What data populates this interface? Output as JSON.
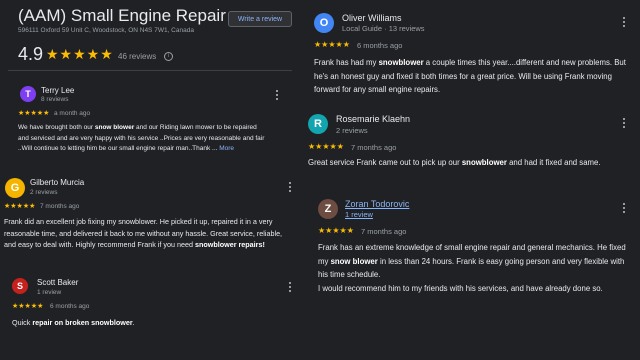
{
  "business": {
    "title": "(AAM) Small Engine Repair",
    "address": "596111 Oxford 59 Unit C, Woodstock, ON N4S 7W1, Canada",
    "write_review_label": "Write a review",
    "rating": "4.9",
    "stars": "★★★★★",
    "review_count": "46 reviews",
    "info_glyph": "i"
  },
  "reviews_left": [
    {
      "initial": "T",
      "avatar_color": "#7e3ff2",
      "name": "Terry Lee",
      "meta": "8 reviews",
      "stars": "★★★★★",
      "when": "a month ago",
      "text_parts": [
        "We have brought both our ",
        "snow blower",
        " and our Riding lawn mower to be repaired and serviced and are very happy with his service ..Prices are very reasonable and fair ..Will continue to letting him be our small engine repair man..Thank ... "
      ],
      "more": "More"
    },
    {
      "initial": "G",
      "avatar_color": "#f4b400",
      "name": "Gilberto Murcia",
      "meta": "2 reviews",
      "stars": "★★★★★",
      "when": "7 months ago",
      "text_parts": [
        "Frank did an excellent job fixing my snowblower. He picked it up, repaired it in a very reasonable time, and delivered it back to me without any hassle. Great service, reliable, and easy to deal with. Highly recommend Frank if you need ",
        "snowblower repairs!",
        ""
      ]
    },
    {
      "initial": "S",
      "avatar_color": "#c5221f",
      "name": "Scott Baker",
      "meta": "1 review",
      "stars": "★★★★★",
      "when": "6 months ago",
      "text_parts": [
        "Quick ",
        "repair on broken snowblower",
        "."
      ]
    }
  ],
  "reviews_right": [
    {
      "initial": "O",
      "avatar_color": "#4285f4",
      "name": "Oliver Williams",
      "meta": "Local Guide · 13 reviews",
      "stars": "★★★★★",
      "when": "6 months ago",
      "text_parts": [
        "Frank has had my ",
        "snowblower",
        " a couple times this year....different and new problems. But he's an honest guy and fixed it both times for a great price. Will be using Frank moving forward for any small engine repairs."
      ]
    },
    {
      "initial": "R",
      "avatar_color": "#12a4af",
      "name": "Rosemarie Klaehn",
      "meta": "2 reviews",
      "stars": "★★★★★",
      "when": "7 months ago",
      "text_parts": [
        "Great service Frank came out to pick up our ",
        "snowblower",
        " and had it fixed and same."
      ]
    },
    {
      "initial": "Z",
      "avatar_color": "#6d4c41",
      "name": "Zoran Todorovic",
      "meta": "1 review",
      "stars": "★★★★★",
      "when": "7 months ago",
      "text_parts": [
        "Frank has an extreme knowledge of small engine repair and general mechanics. He fixed my ",
        "snow blower",
        " in less than 24 hours. Frank is easy going person and very flexible with his time schedule."
      ],
      "text_extra": "I would recommend him to my friends with his services, and have already done so."
    }
  ]
}
